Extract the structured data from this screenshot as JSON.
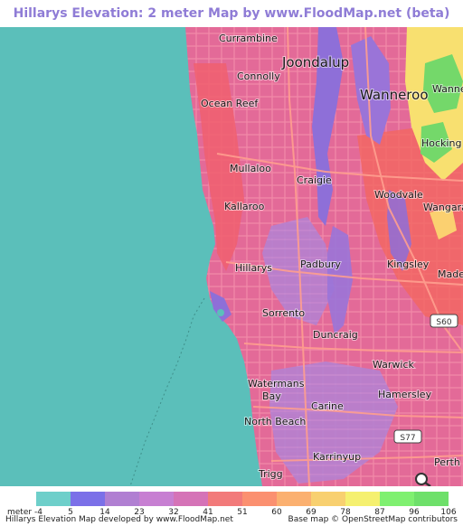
{
  "title": "Hillarys Elevation: 2 meter Map by www.FloodMap.net (beta)",
  "map": {
    "colors": {
      "ocean": "#5bbfba",
      "land_low": "#e06aa8",
      "land_mid": "#f0607a",
      "land_high": "#f06a5c",
      "urban_purple": "#b07fd2",
      "deep_purple": "#8e6fd8",
      "green": "#6ad46a",
      "yellow": "#f0e070",
      "road": "#ffb0a0"
    },
    "places": [
      {
        "name": "Currambine",
        "size": "small"
      },
      {
        "name": "Joondalup",
        "size": "big"
      },
      {
        "name": "Connolly",
        "size": "small"
      },
      {
        "name": "Wanneroo",
        "size": "big"
      },
      {
        "name": "Wanner",
        "size": "small"
      },
      {
        "name": "Ocean Reef",
        "size": "small"
      },
      {
        "name": "Hocking",
        "size": "small"
      },
      {
        "name": "Mullaloo",
        "size": "small"
      },
      {
        "name": "Craigie",
        "size": "small"
      },
      {
        "name": "Woodvale",
        "size": "small"
      },
      {
        "name": "Kallaroo",
        "size": "small"
      },
      {
        "name": "Wangara",
        "size": "small"
      },
      {
        "name": "Hillarys",
        "size": "small"
      },
      {
        "name": "Padbury",
        "size": "small"
      },
      {
        "name": "Kingsley",
        "size": "small"
      },
      {
        "name": "Madel",
        "size": "small"
      },
      {
        "name": "Sorrento",
        "size": "small"
      },
      {
        "name": "Duncraig",
        "size": "small"
      },
      {
        "name": "Warwick",
        "size": "small"
      },
      {
        "name": "Watermans",
        "size": "small"
      },
      {
        "name": "Bay",
        "size": "small"
      },
      {
        "name": "Hamersley",
        "size": "small"
      },
      {
        "name": "North Beach",
        "size": "small"
      },
      {
        "name": "Carine",
        "size": "small"
      },
      {
        "name": "Karrinyup",
        "size": "small"
      },
      {
        "name": "Trigg",
        "size": "small"
      },
      {
        "name": "Perth",
        "size": "small"
      }
    ],
    "road_shields": [
      "S60",
      "S77"
    ]
  },
  "legend": {
    "unit": "meter",
    "values": [
      "-4",
      "5",
      "14",
      "23",
      "32",
      "41",
      "51",
      "60",
      "69",
      "78",
      "87",
      "96",
      "106"
    ],
    "swatch_colors": [
      "#6ecfca",
      "#7b70e8",
      "#b07fd2",
      "#c77fd2",
      "#d573b7",
      "#f27a7a",
      "#fb9070",
      "#fbb070",
      "#f8d070",
      "#f5f070",
      "#7ff070",
      "#6ee06a"
    ]
  },
  "credits": {
    "left": "Hillarys Elevation Map developed by www.FloodMap.net",
    "right": "Base map © OpenStreetMap contributors"
  },
  "icons": {
    "search": "magnifier-icon",
    "osm_logo": "openstreetmap-logo"
  }
}
